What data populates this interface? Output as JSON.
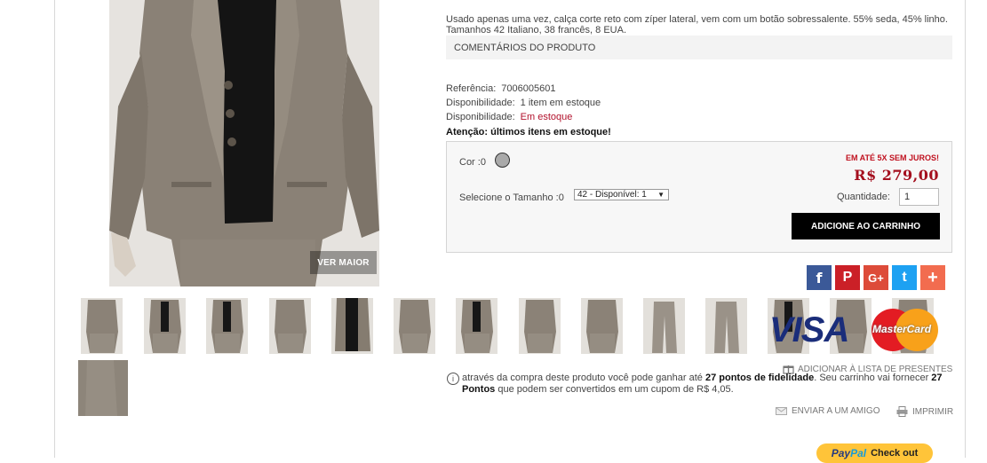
{
  "product": {
    "description_line1": "Usado apenas uma vez, calça corte reto com zíper lateral, vem com um botão sobressalente. 55% seda, 45% linho.",
    "description_line2": "Tamanhos 42 Italiano, 38 francês, 8 EUA.",
    "comments_tab": "COMENTÁRIOS DO PRODUTO",
    "reference_label": "Referência:",
    "reference_value": "7006005601",
    "availability_label": "Disponibilidade:",
    "availability_value1": "1 item em estoque",
    "availability_label2": "Disponibilidade:",
    "availability_value2": "Em estoque",
    "attention": "Atenção: últimos itens em estoque!",
    "view_larger": "VER MAIOR"
  },
  "purchase": {
    "color_label": "Cor :0",
    "color_swatch": "#aaaaaa",
    "size_label": "Selecione o Tamanho :0",
    "size_selected": "42 - Disponível: 1",
    "installments": "EM ATÉ 5X SEM JUROS!",
    "price": "R$ 279,00",
    "quantity_label": "Quantidade:",
    "quantity_value": "1",
    "add_to_cart": "ADICIONE AO CARRINHO"
  },
  "social": {
    "facebook": "f",
    "pinterest": "P",
    "googleplus": "G+",
    "twitter": "t",
    "more": "+"
  },
  "cards": {
    "visa": "VISA",
    "mastercard": "MasterCard"
  },
  "loyalty": {
    "gift_list": "ADICIONAR À LISTA DE PRESENTES",
    "part1": "através da compra deste produto você pode ganhar até ",
    "points1": "27 pontos de fidelidade",
    "part2": ". Seu carrinho vai fornecer ",
    "points2": "27 Pontos",
    "part3": " que podem ser convertidos em um cupom de R$ 4,05."
  },
  "actions": {
    "send_friend": "ENVIAR A UM AMIGO",
    "print": "IMPRIMIR",
    "paypal_brand_1": "Pay",
    "paypal_brand_2": "Pal",
    "paypal_checkout": "Check out"
  }
}
